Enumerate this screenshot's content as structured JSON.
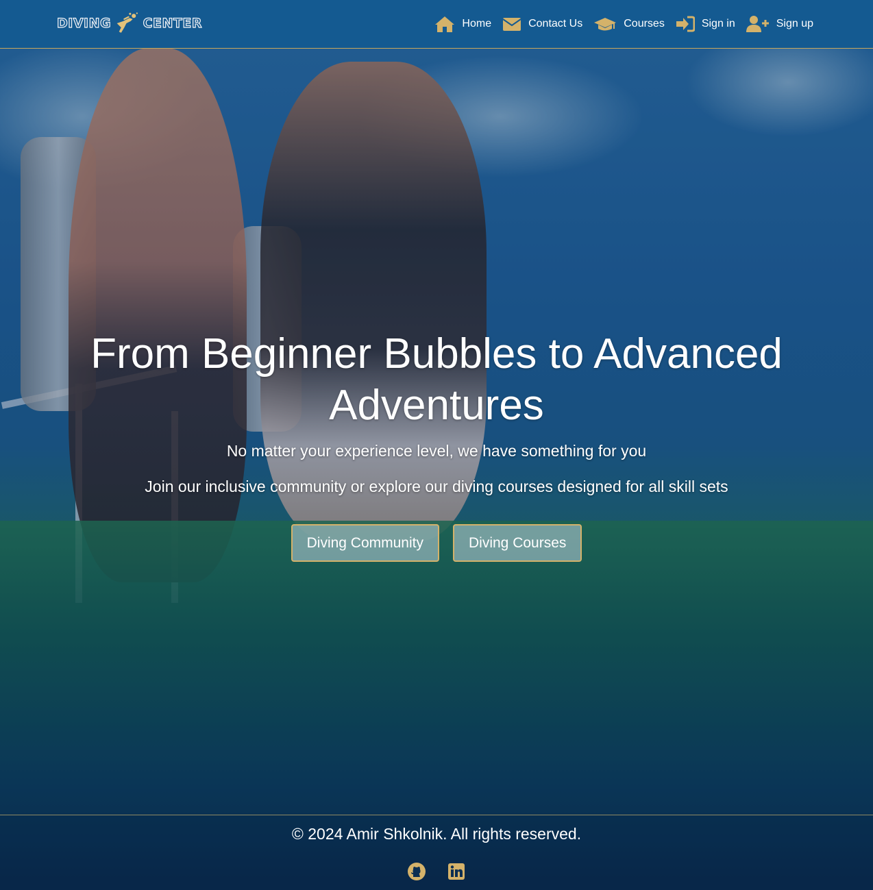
{
  "nav": {
    "logo": {
      "left_word": "DIVING",
      "right_word": "CENTER",
      "icon": "scuba-diver-icon"
    },
    "links": [
      {
        "label": "Home",
        "icon": "home-icon"
      },
      {
        "label": "Contact Us",
        "icon": "envelope-icon"
      },
      {
        "label": "Courses",
        "icon": "graduation-cap-icon"
      },
      {
        "label": "Sign in",
        "icon": "sign-in-icon"
      },
      {
        "label": "Sign up",
        "icon": "user-plus-icon"
      }
    ]
  },
  "hero": {
    "title": "From Beginner Bubbles to Advanced Adventures",
    "subtitle": "No matter your experience level, we have something for you",
    "description": "Join our inclusive community or explore our diving courses designed for all skill sets",
    "buttons": [
      {
        "label": "Diving Community"
      },
      {
        "label": "Diving Courses"
      }
    ]
  },
  "footer": {
    "copyright": "© 2024 Amir Shkolnik. All rights reserved.",
    "socials": [
      {
        "icon": "github-icon"
      },
      {
        "icon": "linkedin-icon"
      }
    ]
  },
  "colors": {
    "nav_bg": "#145a91",
    "accent_gold": "#d4b26a",
    "text": "#ffffff"
  }
}
